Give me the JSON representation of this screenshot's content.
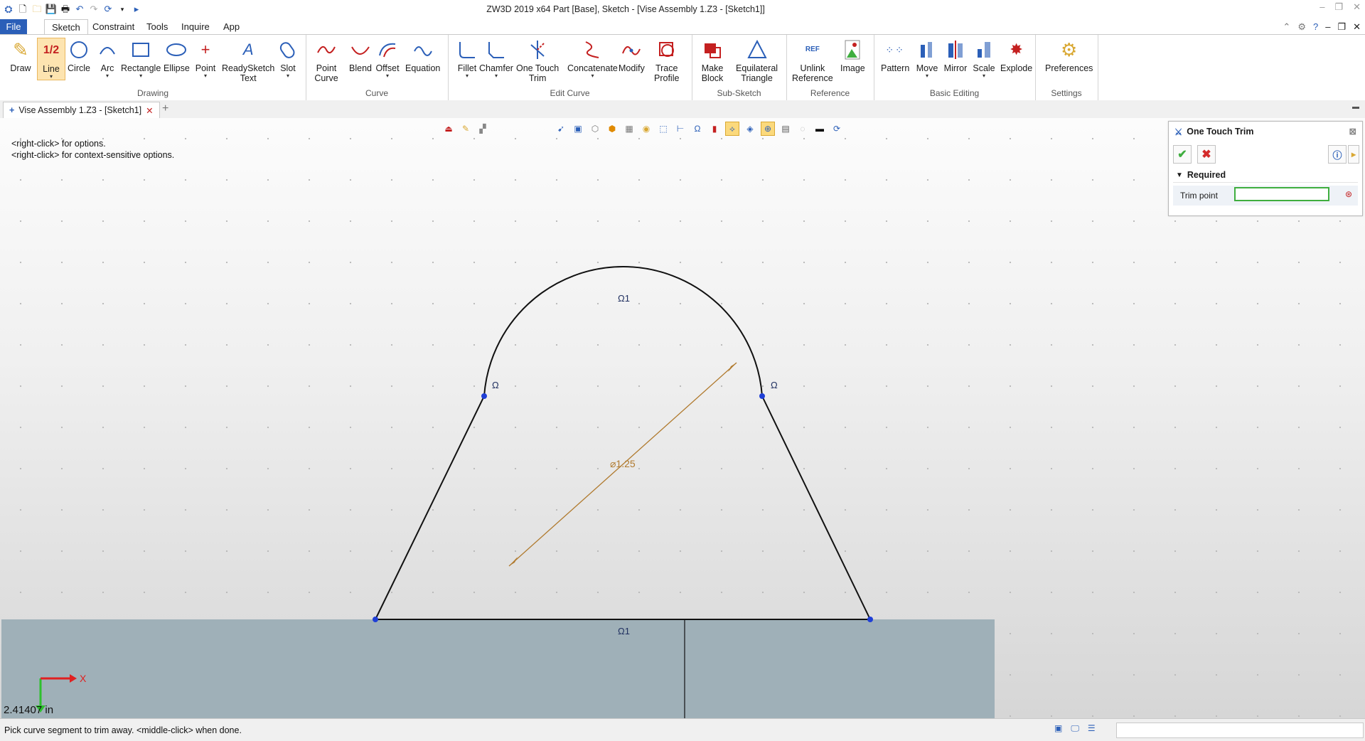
{
  "app": {
    "title": "ZW3D 2019  x64          Part [Base],  Sketch - [Vise Assembly 1.Z3 - [Sketch1]]"
  },
  "menu": {
    "tabs": [
      "File",
      "Sketch",
      "Constraint",
      "Tools",
      "Inquire",
      "App"
    ]
  },
  "ribbon": {
    "groups": [
      {
        "label": "Drawing",
        "buttons": [
          "Draw",
          "Line",
          "Circle",
          "Arc",
          "Rectangle",
          "Ellipse",
          "Point",
          "ReadySketch\nText",
          "Slot"
        ]
      },
      {
        "label": "Curve",
        "buttons": [
          "Point\nCurve",
          "Blend",
          "Offset",
          "Equation"
        ]
      },
      {
        "label": "Edit Curve",
        "buttons": [
          "Fillet",
          "Chamfer",
          "One Touch\nTrim",
          "Concatenate",
          "Modify",
          "Trace\nProfile"
        ]
      },
      {
        "label": "Sub-Sketch",
        "buttons": [
          "Make\nBlock",
          "Equilateral\nTriangle"
        ]
      },
      {
        "label": "Reference",
        "buttons": [
          "Unlink\nReference",
          "Image"
        ]
      },
      {
        "label": "Basic Editing",
        "buttons": [
          "Pattern",
          "Move",
          "Mirror",
          "Scale",
          "Explode"
        ]
      },
      {
        "label": "Settings",
        "buttons": [
          "Preferences"
        ]
      }
    ]
  },
  "document_tab": {
    "label": "Vise Assembly 1.Z3 - [Sketch1]"
  },
  "hints": {
    "line1": "<right-click> for options.",
    "line2": "<right-click> for context-sensitive options."
  },
  "sketch": {
    "dimension_label": "⌀1.25",
    "constraint_symbol_top": "Ω1",
    "constraint_symbol_left": "Ω",
    "constraint_symbol_right": "Ω",
    "constraint_symbol_bottom": "Ω1",
    "axis_x_label": "X",
    "coordinate_readout": "2.41407 in"
  },
  "panel": {
    "title": "One Touch Trim",
    "section": "Required",
    "field_label": "Trim point",
    "field_value": ""
  },
  "status": {
    "message": "Pick curve segment to trim away.  <middle-click> when done."
  },
  "colors": {
    "file_tab": "#2b5fb8",
    "sketch_line": "#111111",
    "dimension": "#b07a2e",
    "endpoint": "#1f3fd6",
    "accept": "#3fae3f",
    "cancel": "#d42b2b",
    "plate_fill": "#9fb0b8"
  }
}
